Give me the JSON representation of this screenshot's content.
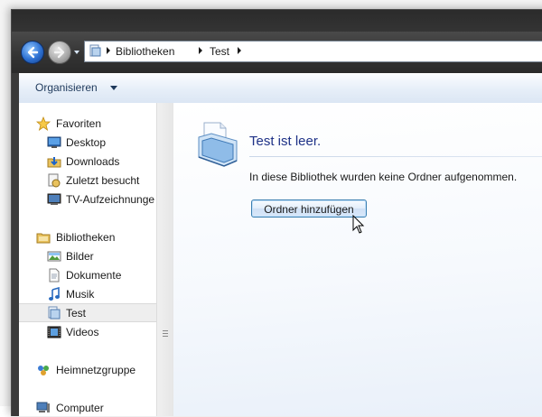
{
  "address": {
    "crumbs": [
      "Bibliotheken",
      "Test"
    ]
  },
  "toolbar": {
    "organize_label": "Organisieren"
  },
  "navpane": {
    "favorites": {
      "label": "Favoriten",
      "items": [
        {
          "label": "Desktop",
          "icon": "desktop-icon"
        },
        {
          "label": "Downloads",
          "icon": "downloads-icon"
        },
        {
          "label": "Zuletzt besucht",
          "icon": "recent-places-icon"
        },
        {
          "label": "TV-Aufzeichnungen",
          "icon": "tv-recordings-icon"
        }
      ]
    },
    "libraries": {
      "label": "Bibliotheken",
      "items": [
        {
          "label": "Bilder",
          "icon": "pictures-icon"
        },
        {
          "label": "Dokumente",
          "icon": "documents-icon"
        },
        {
          "label": "Musik",
          "icon": "music-icon"
        },
        {
          "label": "Test",
          "icon": "library-icon",
          "selected": true
        },
        {
          "label": "Videos",
          "icon": "videos-icon"
        }
      ]
    },
    "homegroup": {
      "label": "Heimnetzgruppe"
    },
    "computer": {
      "label": "Computer"
    }
  },
  "content": {
    "title": "Test ist leer.",
    "description": "In diese Bibliothek wurden keine Ordner aufgenommen.",
    "add_button_label": "Ordner hinzufügen"
  },
  "colors": {
    "title_blue": "#1e3287",
    "selection_gray": "#eeeeee",
    "toolbar_text": "#1e395b"
  }
}
